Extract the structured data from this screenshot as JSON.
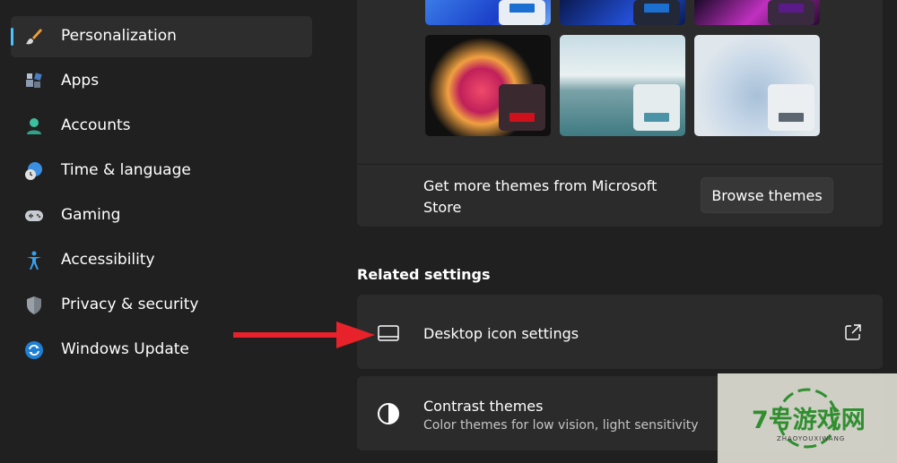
{
  "sidebar": {
    "items": [
      {
        "label": "Personalization",
        "icon": "brush-icon",
        "selected": true
      },
      {
        "label": "Apps",
        "icon": "apps-icon"
      },
      {
        "label": "Accounts",
        "icon": "person-icon"
      },
      {
        "label": "Time & language",
        "icon": "globe-clock-icon"
      },
      {
        "label": "Gaming",
        "icon": "gamepad-icon"
      },
      {
        "label": "Accessibility",
        "icon": "accessibility-icon"
      },
      {
        "label": "Privacy & security",
        "icon": "shield-icon"
      },
      {
        "label": "Windows Update",
        "icon": "sync-icon"
      }
    ]
  },
  "themes": {
    "more_text": "Get more themes from Microsoft Store",
    "browse_label": "Browse themes"
  },
  "related": {
    "heading": "Related settings",
    "desktop_icon": {
      "title": "Desktop icon settings",
      "icon": "monitor-icon",
      "trail_icon": "external-link-icon"
    },
    "contrast": {
      "title": "Contrast themes",
      "subtitle": "Color themes for low vision, light sensitivity",
      "icon": "contrast-icon",
      "trail_icon": "chevron-right-icon"
    }
  },
  "watermark": {
    "text": "7号游戏网",
    "sub": "ZHAOYOUXIWANG"
  },
  "colors": {
    "accent": "#4cc2ff",
    "arrow": "#e8222a",
    "background": "#202020",
    "card": "#2b2b2b"
  }
}
